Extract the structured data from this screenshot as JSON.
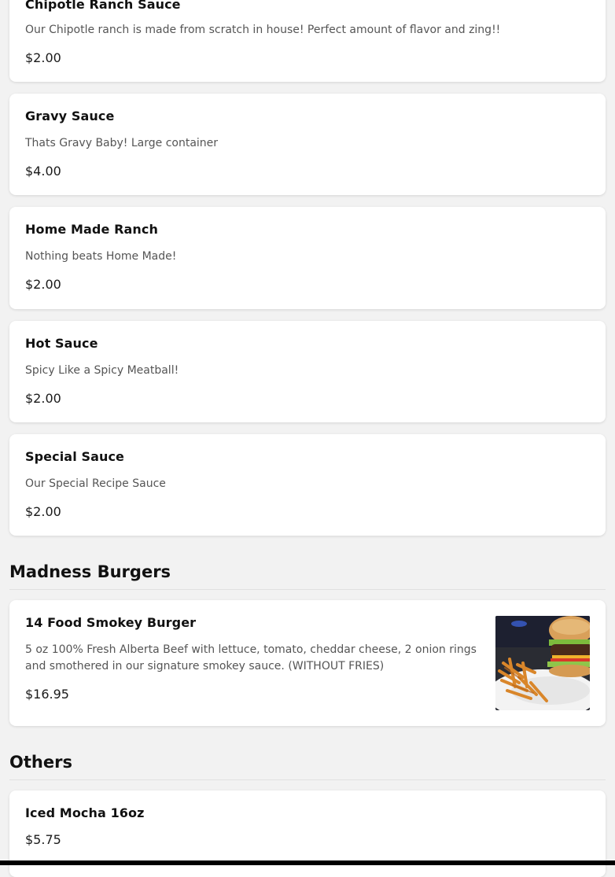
{
  "items": [
    {
      "name": "Chipotle Ranch Sauce",
      "description": "Our Chipotle ranch is made from scratch in house! Perfect amount of flavor and zing!!",
      "price": "$2.00"
    },
    {
      "name": "Gravy Sauce",
      "description": "Thats Gravy Baby! Large container",
      "price": "$4.00"
    },
    {
      "name": "Home Made Ranch",
      "description": "Nothing beats Home Made!",
      "price": "$2.00"
    },
    {
      "name": "Hot Sauce",
      "description": "Spicy Like a Spicy Meatball!",
      "price": "$2.00"
    },
    {
      "name": "Special Sauce",
      "description": "Our Special Recipe Sauce",
      "price": "$2.00"
    }
  ],
  "sections": [
    {
      "title": "Madness Burgers",
      "items": [
        {
          "name": "14 Food Smokey Burger",
          "description_line1": "5 oz 100% Fresh Alberta Beef with lettuce, tomato, cheddar cheese, 2 onion rings",
          "description_line2": "and smothered in our signature smokey sauce. (WITHOUT FRIES)",
          "price": "$16.95",
          "image": "burger-and-fries-photo"
        }
      ]
    },
    {
      "title": "Others",
      "items": [
        {
          "name": "Iced Mocha 16oz",
          "price": "$5.75"
        }
      ]
    }
  ]
}
